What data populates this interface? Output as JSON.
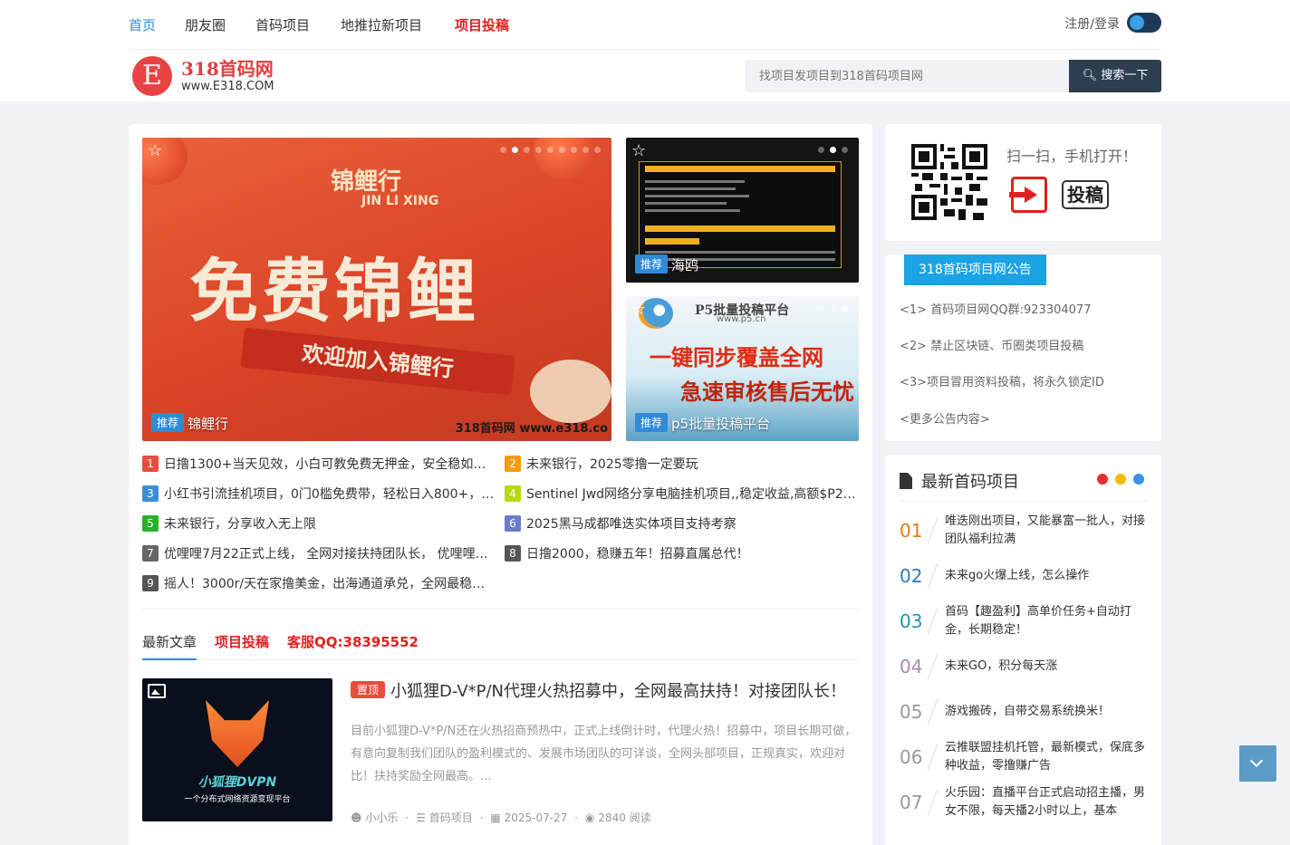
{
  "nav": {
    "items": [
      "首页",
      "朋友圈",
      "首码项目",
      "地推拉新项目",
      "项目投稿"
    ],
    "login": "注册/登录"
  },
  "logo": {
    "mark": "E",
    "name": "318首码网",
    "url": "www.E318.COM"
  },
  "search": {
    "placeholder": "找项目发项目到318首码项目网",
    "button": "搜索一下"
  },
  "slides": [
    {
      "badge": "推荐",
      "title": "锦鲤行",
      "brand": "锦鲤行",
      "brand_en": "JIN LI XING",
      "headline": "免费锦鲤",
      "ribbon": "欢迎加入锦鲤行",
      "watermark": "318首码网 www.e318.co"
    },
    {
      "badge": "推荐",
      "title": "海鸥"
    },
    {
      "badge": "推荐",
      "title": "p5批量投稿平台",
      "brand": "P5批量投稿平台",
      "brand_url": "www.p5.cn",
      "line1": "一键同步覆盖全网",
      "line2": "急速审核售后无忧"
    }
  ],
  "toplist": [
    {
      "n": "1",
      "text": "日撸1300+当天见效，小白可教免费无押金，安全稳如泰…"
    },
    {
      "n": "2",
      "text": "未来银行，2025零撸一定要玩"
    },
    {
      "n": "3",
      "text": "小红书引流挂机项目，0门0槛免费带，轻松日入800+，可…"
    },
    {
      "n": "4",
      "text": "Sentinel Jwd网络分享电脑挂机项目,,稳定收益,高额$P2P…"
    },
    {
      "n": "5",
      "text": "未来银行，分享收入无上限"
    },
    {
      "n": "6",
      "text": "2025黑马成都唯迭实体项目支持考察"
    },
    {
      "n": "7",
      "text": "优哩哩7月22正式上线， 全网对接扶持团队长， 优哩哩全…"
    },
    {
      "n": "8",
      "text": "日撸2000，稳赚五年！招募直属总代！"
    },
    {
      "n": "9",
      "text": "摇人！3000r/天在家撸美金，出海通道承兑，全网最稳项…"
    }
  ],
  "toplist_colors": [
    "#e84c3d",
    "#f39c12",
    "#3a8fd8",
    "#b6d816",
    "#2ab12a",
    "#6a7bc8",
    "#666666",
    "#555555",
    "#555555"
  ],
  "tabs": [
    "最新文章",
    "项目投稿",
    "客服QQ:38395552"
  ],
  "post": {
    "pin": "置顶",
    "title": "小狐狸D-V*P/N代理火热招募中，全网最高扶持！对接团队长！",
    "excerpt": "目前小狐狸D-V*P/N还在火热招商预热中，正式上线倒计时，代理火热！招募中，项目长期可做，有意向复制我们团队的盈利模式的、发展市场团队的可详谈，全网头部项目，正规真实，欢迎对比！扶持奖励全网最高。...",
    "thumb_title": "小狐狸DVPN",
    "thumb_sub": "一个分布式网络资源变现平台",
    "author": "小小乐",
    "category": "首码项目",
    "date": "2025-07-27",
    "views": "2840 阅读"
  },
  "qr_card": {
    "text": "扫一扫，手机打开！",
    "submit": "投稿"
  },
  "notice": {
    "title": "318首码项目网公告",
    "items": [
      "<1> 首码项目网QQ群:923304077",
      "<2> 禁止区块链、币圈类项目投稿",
      "<3>项目冒用资料投稿，将永久锁定ID",
      "<更多公告内容>"
    ]
  },
  "latest": {
    "title": "最新首码项目",
    "items": [
      {
        "n": "01",
        "text": "唯迭刚出项目，又能暴富一批人，对接团队福利拉满"
      },
      {
        "n": "02",
        "text": "未来go火爆上线，怎么操作"
      },
      {
        "n": "03",
        "text": "首码【趣盈利】高单价任务+自动打金，长期稳定！"
      },
      {
        "n": "04",
        "text": "未来GO，积分每天涨"
      },
      {
        "n": "05",
        "text": "游戏搬砖，自带交易系统换米！"
      },
      {
        "n": "06",
        "text": "云推联盟挂机托管，最新模式，保底多种收益，零撸赚广告"
      },
      {
        "n": "07",
        "text": "火乐园：直播平台正式启动招主播，男女不限，每天播2小时以上，基本"
      }
    ],
    "colors": [
      "#e07b16",
      "#2d7bb8",
      "#1a9aa8",
      "#a88ab0",
      "#999999",
      "#999999",
      "#999999"
    ]
  },
  "colors": {
    "accent": "#2d8bd8",
    "hot": "#e02020",
    "notice": "#1aa4e4"
  }
}
